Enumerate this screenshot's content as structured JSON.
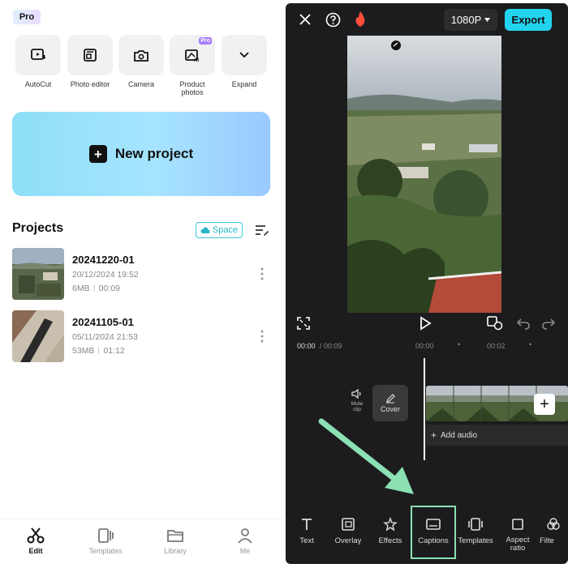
{
  "left": {
    "pro_badge": "Pro",
    "tools": [
      {
        "label": "AutoCut",
        "icon": "autocut-icon"
      },
      {
        "label": "Photo editor",
        "icon": "photo-editor-icon"
      },
      {
        "label": "Camera",
        "icon": "camera-icon"
      },
      {
        "label": "Product\nphotos",
        "icon": "product-photos-icon",
        "badge": "Pro"
      },
      {
        "label": "Expand",
        "icon": "chevron-down-icon"
      }
    ],
    "new_project": "New project",
    "projects_title": "Projects",
    "space_label": "Space",
    "projects": [
      {
        "name": "20241220-01",
        "date": "20/12/2024 19:52",
        "size": "6MB",
        "duration": "00:09"
      },
      {
        "name": "20241105-01",
        "date": "05/11/2024 21:53",
        "size": "53MB",
        "duration": "01:12"
      }
    ],
    "nav": [
      {
        "label": "Edit",
        "icon": "scissors-icon",
        "active": true
      },
      {
        "label": "Templates",
        "icon": "templates-icon",
        "active": false
      },
      {
        "label": "Library",
        "icon": "folder-icon",
        "active": false
      },
      {
        "label": "Me",
        "icon": "person-icon",
        "active": false
      }
    ]
  },
  "right": {
    "resolution": "1080P",
    "export": "Export",
    "time_current": "00:00",
    "time_total": "/ 00:09",
    "ruler": [
      "00:00",
      "00:02"
    ],
    "mute_label": "Mute\nclip",
    "cover_label": "Cover",
    "add_audio": "Add audio",
    "toolbar": [
      {
        "label": "Text",
        "icon": "text-icon"
      },
      {
        "label": "Overlay",
        "icon": "overlay-icon"
      },
      {
        "label": "Effects",
        "icon": "effects-icon"
      },
      {
        "label": "Captions",
        "icon": "captions-icon"
      },
      {
        "label": "Templates",
        "icon": "templates-icon"
      },
      {
        "label": "Aspect\nratio",
        "icon": "aspect-ratio-icon"
      },
      {
        "label": "Filte",
        "icon": "filter-icon"
      }
    ],
    "colors": {
      "accent": "#22d3ee",
      "highlight": "#8be0b4",
      "fire": "#ff4d3a"
    }
  }
}
